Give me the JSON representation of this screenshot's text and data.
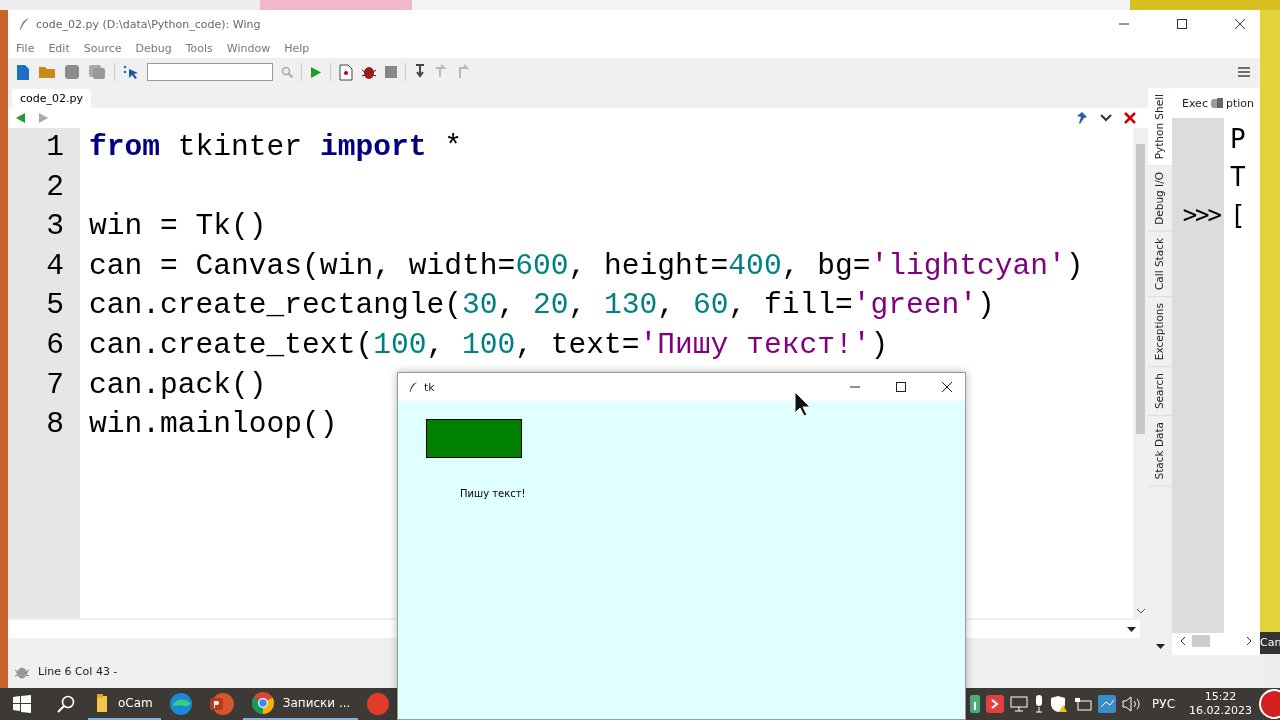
{
  "wing_window": {
    "title": "code_02.py (D:\\data\\Python_code): Wing",
    "menu": [
      "File",
      "Edit",
      "Source",
      "Debug",
      "Tools",
      "Window",
      "Help"
    ],
    "editor_tab": {
      "label": "code_02.py",
      "selected": true
    },
    "code_lines": [
      {
        "number": "1",
        "tokens": [
          {
            "kind": "keyword",
            "text": "from"
          },
          {
            "kind": "plain",
            "text": " tkinter "
          },
          {
            "kind": "keyword",
            "text": "import"
          },
          {
            "kind": "plain",
            "text": " *"
          }
        ]
      },
      {
        "number": "2"
      },
      {
        "number": "3",
        "tokens": [
          {
            "kind": "plain",
            "text": "win = Tk()"
          }
        ]
      },
      {
        "number": "4",
        "tokens": [
          {
            "kind": "plain",
            "text": "can = Canvas(win, width="
          },
          {
            "kind": "number",
            "text": "600"
          },
          {
            "kind": "plain",
            "text": ", height="
          },
          {
            "kind": "number",
            "text": "400"
          },
          {
            "kind": "plain",
            "text": ", bg="
          },
          {
            "kind": "string",
            "text": "'lightcyan'"
          },
          {
            "kind": "plain",
            "text": ")"
          }
        ]
      },
      {
        "number": "5",
        "tokens": [
          {
            "kind": "plain",
            "text": "can.create_rectangle("
          },
          {
            "kind": "number",
            "text": "30"
          },
          {
            "kind": "plain",
            "text": ", "
          },
          {
            "kind": "number",
            "text": "20"
          },
          {
            "kind": "plain",
            "text": ", "
          },
          {
            "kind": "number",
            "text": "130"
          },
          {
            "kind": "plain",
            "text": ", "
          },
          {
            "kind": "number",
            "text": "60"
          },
          {
            "kind": "plain",
            "text": ", fill="
          },
          {
            "kind": "string",
            "text": "'green'"
          },
          {
            "kind": "plain",
            "text": ")"
          }
        ]
      },
      {
        "number": "6",
        "tokens": [
          {
            "kind": "plain",
            "text": "can.create_text("
          },
          {
            "kind": "number",
            "text": "100"
          },
          {
            "kind": "plain",
            "text": ", "
          },
          {
            "kind": "number",
            "text": "100"
          },
          {
            "kind": "plain",
            "text": ", text="
          },
          {
            "kind": "string",
            "text": "'Пишу текст!'"
          },
          {
            "kind": "plain",
            "text": ")"
          }
        ]
      },
      {
        "number": "7",
        "tokens": [
          {
            "kind": "plain",
            "text": "can.pack()"
          }
        ]
      },
      {
        "number": "8",
        "tokens": [
          {
            "kind": "plain",
            "text": "win.mainloop()"
          }
        ]
      }
    ],
    "side_tabs": [
      {
        "label": "Python Shell",
        "selected": true
      },
      {
        "label": "Debug I/O",
        "selected": false
      },
      {
        "label": "Call Stack",
        "selected": false
      },
      {
        "label": "Exceptions",
        "selected": false
      },
      {
        "label": "Search",
        "selected": false
      },
      {
        "label": "Stack Data",
        "selected": false
      }
    ],
    "shell": {
      "tabs": [
        "Exec",
        "ption"
      ],
      "prompt": ">>>",
      "lines": [
        "P",
        "T",
        "["
      ]
    },
    "status": "Line 6 Col 43 -"
  },
  "tk_window": {
    "title": "tk",
    "canvas_text": "Пишу текст!"
  },
  "taskbar": {
    "items": [
      {
        "kind": "folder",
        "label": "oCam",
        "open": true
      },
      {
        "kind": "edge",
        "open": false
      },
      {
        "kind": "powerpoint",
        "open": false
      },
      {
        "kind": "chrome",
        "label": "Записки ...",
        "open": true
      },
      {
        "kind": "yandex",
        "open": false
      }
    ],
    "language": "РУС",
    "time": "15:22",
    "date": "16.02.2023"
  },
  "background_window": {
    "text": "Can"
  }
}
